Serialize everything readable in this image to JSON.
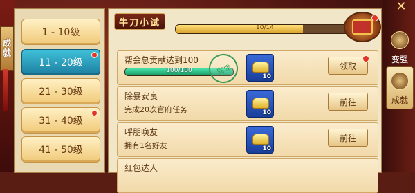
{
  "window": {
    "side_title": "成就",
    "close_glyph": "✕"
  },
  "tabs": [
    {
      "label": "1 - 10级",
      "active": false,
      "dot": false
    },
    {
      "label": "11 - 20级",
      "active": true,
      "dot": true
    },
    {
      "label": "21 - 30级",
      "active": false,
      "dot": false
    },
    {
      "label": "31 - 40级",
      "active": false,
      "dot": true
    },
    {
      "label": "41 - 50级",
      "active": false,
      "dot": false
    }
  ],
  "header": {
    "badge": "牛刀小试",
    "progress_text": "10/14",
    "progress_value": 10,
    "progress_max": 14
  },
  "rows": [
    {
      "name": "帮会总贡献达到100",
      "progress_text": "100/100",
      "progress_fraction": 1.0,
      "stamp_text": "完成",
      "reward_count": "10",
      "button": "领取",
      "button_dot": true
    },
    {
      "name": "除暴安良",
      "desc": "完成20次官府任务",
      "reward_count": "10",
      "button": "前往"
    },
    {
      "name": "呼朋唤友",
      "desc": "拥有1名好友",
      "reward_count": "10",
      "button": "前往"
    },
    {
      "name": "红包达人"
    }
  ],
  "side": {
    "top_label": "变强",
    "active_label": "成就"
  },
  "colors": {
    "active_tab": "#1d7fa1",
    "progress_green": "#1a9a66",
    "red_dot": "#e0342c"
  }
}
